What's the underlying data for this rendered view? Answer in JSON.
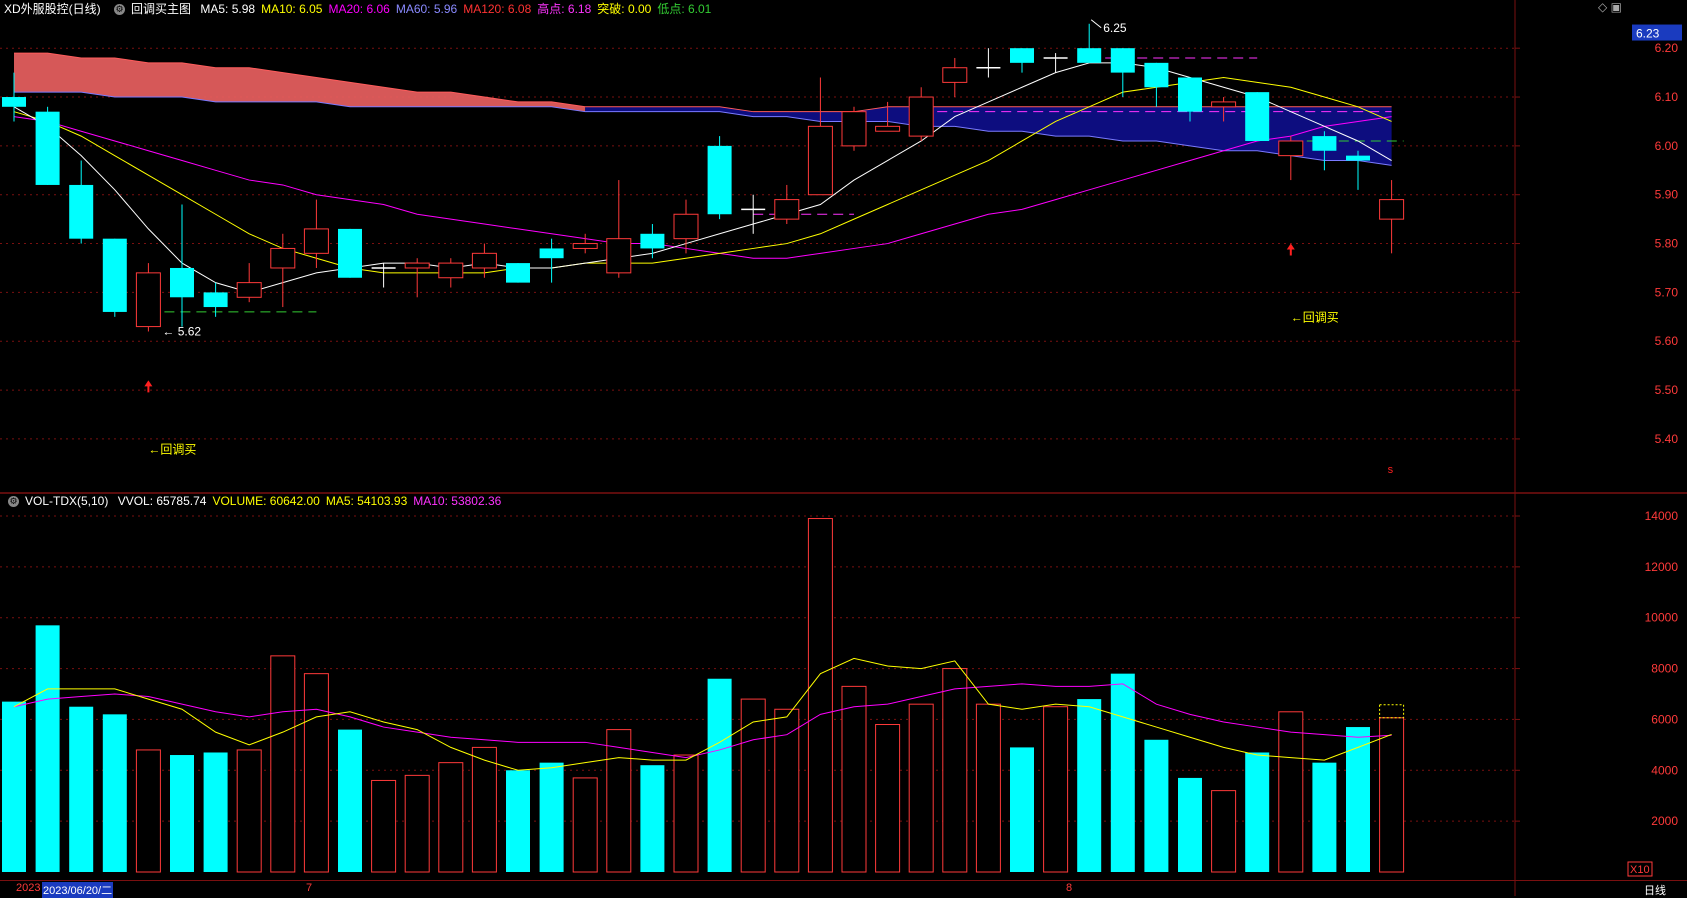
{
  "header": {
    "stock_name": "XD外服股控",
    "period": "(日线)",
    "indicator_name": "回调买主图",
    "indicators": [
      {
        "label": "MA5:",
        "value": "5.98",
        "color": "#ffffff"
      },
      {
        "label": "MA10:",
        "value": "6.05",
        "color": "#ffff00"
      },
      {
        "label": "MA20:",
        "value": "6.06",
        "color": "#ff00ff"
      },
      {
        "label": "MA60:",
        "value": "5.96",
        "color": "#8a8aff"
      },
      {
        "label": "MA120:",
        "value": "6.08",
        "color": "#ff3333"
      },
      {
        "label": "高点:",
        "value": "6.18",
        "color": "#ff33ff"
      },
      {
        "label": "突破:",
        "value": "0.00",
        "color": "#ffff00"
      },
      {
        "label": "低点:",
        "value": "6.01",
        "color": "#33cc33"
      }
    ]
  },
  "vol_header": {
    "name": "VOL-TDX(5,10)",
    "items": [
      {
        "label": "VVOL:",
        "value": "65785.74",
        "color": "#ffffff"
      },
      {
        "label": "VOLUME:",
        "value": "60642.00",
        "color": "#ffff00"
      },
      {
        "label": "MA5:",
        "value": "54103.93",
        "color": "#ffff00"
      },
      {
        "label": "MA10:",
        "value": "53802.36",
        "color": "#ff33ff"
      }
    ]
  },
  "price_axis": {
    "ticks": [
      "6.20",
      "6.10",
      "6.00",
      "5.90",
      "5.80",
      "5.70",
      "5.60",
      "5.50",
      "5.40"
    ],
    "current": "6.23"
  },
  "volume_axis": {
    "ticks": [
      "14000",
      "12000",
      "10000",
      "8000",
      "6000",
      "4000",
      "2000"
    ],
    "unit": "X10"
  },
  "annotations": {
    "high_label": "6.25",
    "low_label": "5.62",
    "signal_text_1": "←回调买",
    "signal_text_2": "←回调买",
    "s_marker": "s"
  },
  "bottom_bar": {
    "year": "2023",
    "cursor_date": "2023/06/20/二",
    "month_7": "7",
    "month_8": "8",
    "period_label": "日线"
  },
  "colors": {
    "up": "#ff3a3a",
    "down": "#00ffff",
    "ma5": "#ffffff",
    "ma10": "#ffff00",
    "ma20": "#ff00ff",
    "grid": "#7a1010"
  },
  "chart_data": {
    "type": "candlestick",
    "candles": [
      {
        "o": 6.1,
        "h": 6.15,
        "l": 6.05,
        "c": 6.08
      },
      {
        "o": 6.07,
        "h": 6.08,
        "l": 5.92,
        "c": 5.92
      },
      {
        "o": 5.92,
        "h": 5.97,
        "l": 5.8,
        "c": 5.81
      },
      {
        "o": 5.81,
        "h": 5.81,
        "l": 5.65,
        "c": 5.66
      },
      {
        "o": 5.63,
        "h": 5.76,
        "l": 5.62,
        "c": 5.74
      },
      {
        "o": 5.75,
        "h": 5.88,
        "l": 5.63,
        "c": 5.69
      },
      {
        "o": 5.7,
        "h": 5.72,
        "l": 5.65,
        "c": 5.67
      },
      {
        "o": 5.69,
        "h": 5.76,
        "l": 5.68,
        "c": 5.72
      },
      {
        "o": 5.75,
        "h": 5.82,
        "l": 5.67,
        "c": 5.79
      },
      {
        "o": 5.78,
        "h": 5.89,
        "l": 5.75,
        "c": 5.83
      },
      {
        "o": 5.83,
        "h": 5.83,
        "l": 5.73,
        "c": 5.73
      },
      {
        "o": 5.75,
        "h": 5.76,
        "l": 5.71,
        "c": 5.75
      },
      {
        "o": 5.75,
        "h": 5.77,
        "l": 5.69,
        "c": 5.76
      },
      {
        "o": 5.73,
        "h": 5.77,
        "l": 5.71,
        "c": 5.76
      },
      {
        "o": 5.75,
        "h": 5.8,
        "l": 5.73,
        "c": 5.78
      },
      {
        "o": 5.76,
        "h": 5.76,
        "l": 5.72,
        "c": 5.72
      },
      {
        "o": 5.79,
        "h": 5.81,
        "l": 5.72,
        "c": 5.77
      },
      {
        "o": 5.79,
        "h": 5.82,
        "l": 5.78,
        "c": 5.8
      },
      {
        "o": 5.74,
        "h": 5.93,
        "l": 5.73,
        "c": 5.81
      },
      {
        "o": 5.82,
        "h": 5.84,
        "l": 5.77,
        "c": 5.79
      },
      {
        "o": 5.81,
        "h": 5.89,
        "l": 5.78,
        "c": 5.86
      },
      {
        "o": 6.0,
        "h": 6.02,
        "l": 5.85,
        "c": 5.86
      },
      {
        "o": 5.87,
        "h": 5.9,
        "l": 5.82,
        "c": 5.87
      },
      {
        "o": 5.85,
        "h": 5.92,
        "l": 5.84,
        "c": 5.89
      },
      {
        "o": 5.9,
        "h": 6.14,
        "l": 5.9,
        "c": 6.04
      },
      {
        "o": 6.0,
        "h": 6.08,
        "l": 5.99,
        "c": 6.07
      },
      {
        "o": 6.03,
        "h": 6.09,
        "l": 6.03,
        "c": 6.04
      },
      {
        "o": 6.02,
        "h": 6.12,
        "l": 6.01,
        "c": 6.1
      },
      {
        "o": 6.13,
        "h": 6.18,
        "l": 6.1,
        "c": 6.16
      },
      {
        "o": 6.16,
        "h": 6.2,
        "l": 6.14,
        "c": 6.16
      },
      {
        "o": 6.2,
        "h": 6.2,
        "l": 6.15,
        "c": 6.17
      },
      {
        "o": 6.18,
        "h": 6.19,
        "l": 6.15,
        "c": 6.18
      },
      {
        "o": 6.2,
        "h": 6.25,
        "l": 6.17,
        "c": 6.17
      },
      {
        "o": 6.2,
        "h": 6.2,
        "l": 6.1,
        "c": 6.15
      },
      {
        "o": 6.17,
        "h": 6.17,
        "l": 6.08,
        "c": 6.12
      },
      {
        "o": 6.14,
        "h": 6.14,
        "l": 6.05,
        "c": 6.07
      },
      {
        "o": 6.08,
        "h": 6.1,
        "l": 6.05,
        "c": 6.09
      },
      {
        "o": 6.11,
        "h": 6.11,
        "l": 6.01,
        "c": 6.01
      },
      {
        "o": 5.98,
        "h": 6.02,
        "l": 5.93,
        "c": 6.01
      },
      {
        "o": 6.02,
        "h": 6.03,
        "l": 5.95,
        "c": 5.99
      },
      {
        "o": 5.98,
        "h": 5.99,
        "l": 5.91,
        "c": 5.97
      },
      {
        "o": 5.85,
        "h": 5.93,
        "l": 5.78,
        "c": 5.89
      }
    ],
    "ma5": [
      6.08,
      6.04,
      5.98,
      5.91,
      5.83,
      5.76,
      5.72,
      5.7,
      5.72,
      5.74,
      5.75,
      5.76,
      5.76,
      5.75,
      5.76,
      5.75,
      5.75,
      5.76,
      5.77,
      5.78,
      5.8,
      5.82,
      5.84,
      5.86,
      5.88,
      5.93,
      5.97,
      6.01,
      6.06,
      6.09,
      6.12,
      6.15,
      6.17,
      6.17,
      6.16,
      6.14,
      6.12,
      6.1,
      6.07,
      6.04,
      6.01,
      5.97
    ],
    "ma10": [
      6.07,
      6.05,
      6.02,
      5.98,
      5.94,
      5.9,
      5.86,
      5.82,
      5.79,
      5.77,
      5.75,
      5.74,
      5.74,
      5.74,
      5.74,
      5.75,
      5.75,
      5.76,
      5.76,
      5.76,
      5.77,
      5.78,
      5.79,
      5.8,
      5.82,
      5.85,
      5.88,
      5.91,
      5.94,
      5.97,
      6.01,
      6.05,
      6.08,
      6.11,
      6.12,
      6.13,
      6.14,
      6.13,
      6.12,
      6.1,
      6.08,
      6.05
    ],
    "ma20": [
      6.06,
      6.05,
      6.03,
      6.01,
      5.99,
      5.97,
      5.95,
      5.93,
      5.92,
      5.9,
      5.89,
      5.88,
      5.86,
      5.85,
      5.84,
      5.83,
      5.82,
      5.81,
      5.8,
      5.8,
      5.79,
      5.78,
      5.77,
      5.77,
      5.78,
      5.79,
      5.8,
      5.82,
      5.84,
      5.86,
      5.87,
      5.89,
      5.91,
      5.93,
      5.95,
      5.97,
      5.99,
      6.01,
      6.02,
      6.04,
      6.05,
      6.06
    ],
    "ma_top": [
      6.19,
      6.19,
      6.18,
      6.18,
      6.17,
      6.17,
      6.16,
      6.16,
      6.15,
      6.14,
      6.13,
      6.12,
      6.11,
      6.11,
      6.1,
      6.09,
      6.09,
      6.08,
      6.08,
      6.08,
      6.08,
      6.08,
      6.07,
      6.07,
      6.07,
      6.07,
      6.08,
      6.08,
      6.08,
      6.08,
      6.08,
      6.08,
      6.08,
      6.08,
      6.08,
      6.08,
      6.08,
      6.08,
      6.08,
      6.08,
      6.08,
      6.08
    ],
    "ma_bottom": [
      6.11,
      6.11,
      6.11,
      6.1,
      6.1,
      6.1,
      6.09,
      6.09,
      6.09,
      6.09,
      6.08,
      6.08,
      6.08,
      6.08,
      6.08,
      6.08,
      6.08,
      6.07,
      6.07,
      6.07,
      6.07,
      6.07,
      6.06,
      6.06,
      6.05,
      6.05,
      6.05,
      6.04,
      6.04,
      6.03,
      6.03,
      6.02,
      6.02,
      6.01,
      6.01,
      6.0,
      5.99,
      5.99,
      5.98,
      5.97,
      5.97,
      5.96
    ],
    "volume": [
      6700,
      9700,
      6500,
      6200,
      4800,
      4600,
      4700,
      4800,
      8500,
      7800,
      5600,
      3600,
      3800,
      4300,
      4900,
      4000,
      4300,
      3700,
      5600,
      4200,
      4600,
      7600,
      6800,
      6400,
      13900,
      7300,
      5800,
      6600,
      8000,
      6600,
      4900,
      6500,
      6800,
      7800,
      5200,
      3700,
      3200,
      4700,
      6300,
      4300,
      5700,
      6064
    ],
    "vol_ma5": [
      6500,
      7200,
      7200,
      7200,
      6800,
      6400,
      5500,
      5000,
      5500,
      6100,
      6300,
      5900,
      5600,
      4900,
      4400,
      4000,
      4100,
      4300,
      4500,
      4400,
      4400,
      5100,
      5900,
      6100,
      7800,
      8400,
      8100,
      8000,
      8300,
      6600,
      6400,
      6600,
      6500,
      6100,
      5700,
      5300,
      4900,
      4600,
      4500,
      4400,
      4900,
      5410
    ],
    "vol_ma10": [
      6500,
      6800,
      6900,
      7000,
      6900,
      6600,
      6300,
      6100,
      6300,
      6400,
      6100,
      5700,
      5500,
      5300,
      5200,
      5100,
      5100,
      5100,
      4900,
      4700,
      4500,
      4800,
      5200,
      5400,
      6200,
      6500,
      6600,
      6900,
      7200,
      7300,
      7400,
      7300,
      7300,
      7400,
      6600,
      6200,
      5900,
      5700,
      5500,
      5400,
      5300,
      5380
    ],
    "xlabel": "",
    "ylabel": "",
    "ylim_price": [
      5.32,
      6.27
    ],
    "ylim_volume": [
      0,
      14000
    ]
  }
}
